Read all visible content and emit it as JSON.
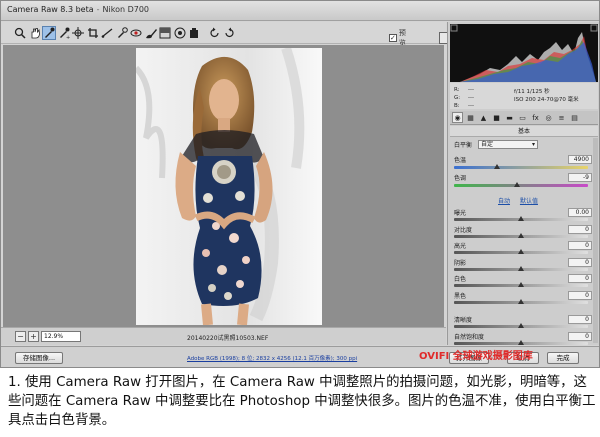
{
  "window": {
    "app_name": "Camera Raw 8.3 beta",
    "camera": "Nikon D700"
  },
  "toolbar": {
    "tools": [
      "zoom-icon",
      "hand-icon",
      "white-balance-icon",
      "color-sampler-icon",
      "targeted-adjustment-icon",
      "crop-icon",
      "straighten-icon",
      "spot-removal-icon",
      "red-eye-icon",
      "adjustment-brush-icon",
      "graduated-filter-icon",
      "radial-filter-icon",
      "preferences-icon",
      "rotate-ccw-icon",
      "rotate-cw-icon"
    ],
    "active_tool": "white-balance-icon",
    "preview_label": "预览",
    "preview_checked": true
  },
  "canvas": {
    "zoom_value": "12.9%",
    "filename": "20140220试黑照10503.NEF"
  },
  "histogram": {
    "readout_left": [
      "R:",
      "G:",
      "B:"
    ],
    "readout_dashes": [
      "---",
      "---",
      "---"
    ],
    "exif_line1": "f/11   1/125 秒",
    "exif_line2": "ISO 200   24-70@70 毫米"
  },
  "panel": {
    "tabs": [
      "basic-tab-icon",
      "tone-curve-tab-icon",
      "detail-tab-icon",
      "hsl-tab-icon",
      "split-toning-tab-icon",
      "lens-tab-icon",
      "fx-tab-icon",
      "camera-calibration-tab-icon",
      "presets-tab-icon",
      "snapshots-tab-icon"
    ],
    "active_tab": 0,
    "section_title": "基本",
    "white_balance_label": "白平衡",
    "white_balance_value": "自定",
    "temperature_label": "色温",
    "temperature_value": "4900",
    "temperature_level": 0.32,
    "tint_label": "色调",
    "tint_value": "-9",
    "tint_level": 0.47,
    "auto_label": "自动",
    "default_label": "默认值",
    "sliders": [
      {
        "label": "曝光",
        "value": "0.00",
        "level": 0.5
      },
      {
        "label": "对比度",
        "value": "0",
        "level": 0.5
      },
      {
        "label": "高光",
        "value": "0",
        "level": 0.5
      },
      {
        "label": "阴影",
        "value": "0",
        "level": 0.5
      },
      {
        "label": "白色",
        "value": "0",
        "level": 0.5
      },
      {
        "label": "黑色",
        "value": "0",
        "level": 0.5
      },
      {
        "label": "清晰度",
        "value": "0",
        "level": 0.5
      },
      {
        "label": "自然饱和度",
        "value": "0",
        "level": 0.5
      }
    ]
  },
  "footer": {
    "save_button": "存储图像...",
    "workflow_link": "Adobe RGB (1998); 8 位; 2832 x 4256 (12.1 百万像素); 300 ppi",
    "open_button": "打开图像",
    "cancel_button": "取消",
    "done_button": "完成"
  },
  "watermark": {
    "text": "OVIFI 全球游戏摄影图库",
    "sub": "photo-game gallery watermark"
  },
  "caption": {
    "text": "1. 使用 Camera Raw 打开图片，在 Camera Raw 中调整照片的拍摄问题，如光影，明暗等，这些问题在 Camera Raw 中调整要比在 Photoshop 中调整快很多。图片的色温不准，使用白平衡工具点击白色背景。"
  },
  "colors": {
    "temperature_gradient": [
      "#3a6fd0",
      "#e8d46a"
    ],
    "tint_gradient": [
      "#3fb54a",
      "#c84ac8"
    ],
    "neutral_slider": [
      "#555555",
      "#e0e0e0"
    ],
    "watermark": "#e02a2a",
    "active_tool_bg": "#9ec1e8"
  }
}
